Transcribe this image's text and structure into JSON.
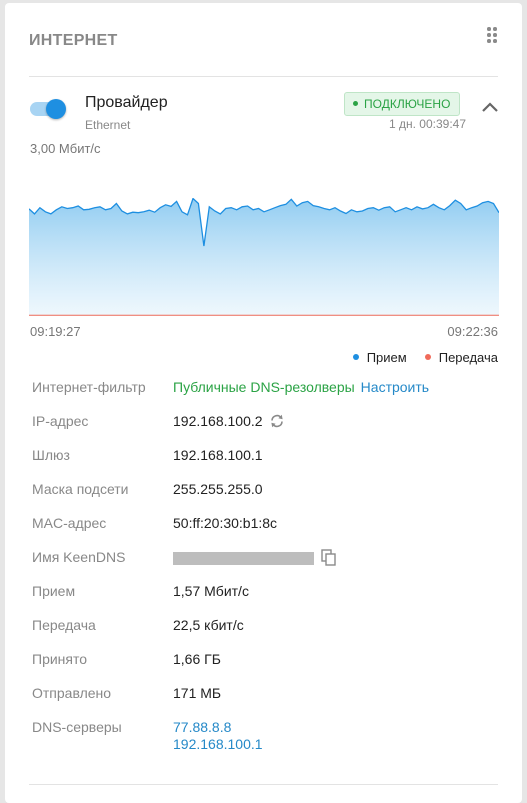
{
  "card": {
    "title": "ИНТЕРНЕТ"
  },
  "provider": {
    "name": "Провайдер",
    "type": "Ethernet",
    "enabled": true,
    "status": "ПОДКЛЮЧЕНО",
    "uptime": "1 дн. 00:39:47",
    "status_color": "#2ba345"
  },
  "chart_data": {
    "type": "area",
    "title": "",
    "ylabel": "",
    "y_max_label": "3,00 Мбит/с",
    "x_start": "09:19:27",
    "x_end": "09:22:36",
    "ylim": [
      0,
      3.0
    ],
    "legend_position": "bottom-right",
    "grid": false,
    "series": [
      {
        "name": "Прием",
        "color": "#1e8fe1",
        "values": [
          2.57,
          2.45,
          2.6,
          2.5,
          2.45,
          2.55,
          2.62,
          2.58,
          2.6,
          2.64,
          2.55,
          2.56,
          2.6,
          2.62,
          2.55,
          2.58,
          2.7,
          2.52,
          2.45,
          2.49,
          2.48,
          2.5,
          2.54,
          2.49,
          2.6,
          2.67,
          2.63,
          2.75,
          2.5,
          2.43,
          2.82,
          2.7,
          1.68,
          2.62,
          2.52,
          2.45,
          2.58,
          2.6,
          2.55,
          2.62,
          2.64,
          2.55,
          2.58,
          2.5,
          2.55,
          2.6,
          2.65,
          2.68,
          2.8,
          2.64,
          2.72,
          2.75,
          2.65,
          2.62,
          2.58,
          2.55,
          2.6,
          2.52,
          2.46,
          2.55,
          2.5,
          2.52,
          2.58,
          2.6,
          2.54,
          2.6,
          2.62,
          2.5,
          2.55,
          2.6,
          2.55,
          2.62,
          2.57,
          2.6,
          2.68,
          2.6,
          2.55,
          2.65,
          2.78,
          2.7,
          2.55,
          2.6,
          2.64,
          2.72,
          2.75,
          2.7,
          2.48
        ]
      },
      {
        "name": "Передача",
        "color": "#f06a5a",
        "values": [
          0.02,
          0.02,
          0.02,
          0.02,
          0.02,
          0.02,
          0.02,
          0.02,
          0.02,
          0.02,
          0.02,
          0.02,
          0.02,
          0.02,
          0.02,
          0.02,
          0.02,
          0.02,
          0.02,
          0.02,
          0.02,
          0.02,
          0.02,
          0.02,
          0.02,
          0.02,
          0.02,
          0.02,
          0.02,
          0.02,
          0.02,
          0.02,
          0.02,
          0.02,
          0.02,
          0.02,
          0.02,
          0.02,
          0.02,
          0.02,
          0.02,
          0.02,
          0.02,
          0.02,
          0.02,
          0.02,
          0.02,
          0.02,
          0.02,
          0.02,
          0.02,
          0.02,
          0.02,
          0.02,
          0.02,
          0.02,
          0.02,
          0.02,
          0.02,
          0.02,
          0.02,
          0.02,
          0.02,
          0.02,
          0.02,
          0.02,
          0.02,
          0.02,
          0.02,
          0.02,
          0.02,
          0.02,
          0.02,
          0.02,
          0.02,
          0.02,
          0.02,
          0.02,
          0.02,
          0.02,
          0.02,
          0.02,
          0.02,
          0.02,
          0.02,
          0.02,
          0.02
        ]
      }
    ]
  },
  "legend": {
    "rx_label": "Прием",
    "tx_label": "Передача",
    "rx_color": "#1e8fe1",
    "tx_color": "#f06a5a"
  },
  "info": {
    "filter": {
      "label": "Интернет-фильтр",
      "value": "Публичные DNS-резолверы",
      "link": "Настроить"
    },
    "ip": {
      "label": "IP-адрес",
      "value": "192.168.100.2"
    },
    "gateway": {
      "label": "Шлюз",
      "value": "192.168.100.1"
    },
    "mask": {
      "label": "Маска подсети",
      "value": "255.255.255.0"
    },
    "mac": {
      "label": "MAC-адрес",
      "value": "50:ff:20:30:b1:8c"
    },
    "keendns": {
      "label": "Имя KeenDNS",
      "value_hidden": true
    },
    "rx_rate": {
      "label": "Прием",
      "value": "1,57 Мбит/с"
    },
    "tx_rate": {
      "label": "Передача",
      "value": "22,5 кбит/с"
    },
    "received": {
      "label": "Принято",
      "value": "1,66 ГБ"
    },
    "sent": {
      "label": "Отправлено",
      "value": "171 МБ"
    },
    "dns": {
      "label": "DNS-серверы",
      "servers": [
        "77.88.8.8",
        "192.168.100.1"
      ]
    }
  }
}
